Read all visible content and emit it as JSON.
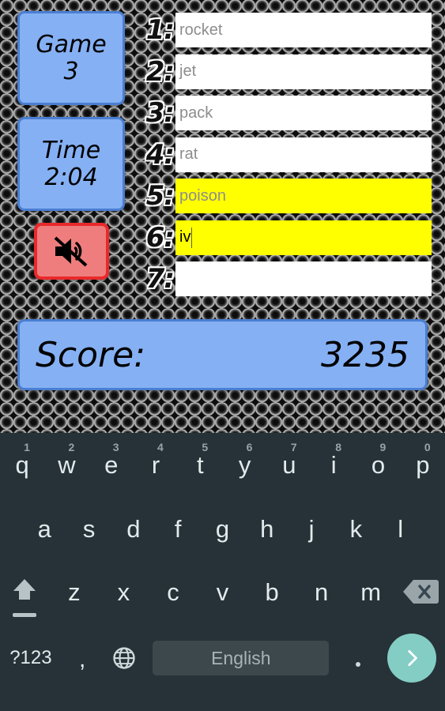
{
  "game": {
    "game_tile": {
      "label": "Game",
      "value": "3"
    },
    "time_tile": {
      "label": "Time",
      "value": "2:04"
    },
    "mute_button": {
      "icon": "speaker-mute-icon",
      "state": "muted"
    },
    "score": {
      "label": "Score:",
      "value": "3235"
    },
    "colors": {
      "tile_fill": "#85b0f3",
      "tile_border": "#4a7ed2",
      "mute_fill": "#ef7d7d",
      "mute_border": "#e8292c",
      "highlight_row": "#ffff00",
      "field_fill": "#ffffff",
      "background": "#8a8a8a"
    },
    "rows": [
      {
        "num": "1:",
        "value": "rocket",
        "highlight": false,
        "active": false
      },
      {
        "num": "2:",
        "value": "jet",
        "highlight": false,
        "active": false
      },
      {
        "num": "3:",
        "value": "pack",
        "highlight": false,
        "active": false
      },
      {
        "num": "4:",
        "value": "rat",
        "highlight": false,
        "active": false
      },
      {
        "num": "5:",
        "value": "poison",
        "highlight": true,
        "active": false
      },
      {
        "num": "6:",
        "value": "iv",
        "highlight": true,
        "active": true
      },
      {
        "num": "7:",
        "value": "",
        "highlight": false,
        "active": false
      }
    ]
  },
  "keyboard": {
    "language_label": "English",
    "symbols_label": "?123",
    "comma_label": ",",
    "period_label": ".",
    "globe_icon": "globe-icon",
    "shift_icon": "shift-icon",
    "backspace_icon": "backspace-icon",
    "enter_icon": "chevron-right-icon",
    "colors": {
      "background": "#263238",
      "key_text": "#e3eaec",
      "hint_text": "#96a3a8",
      "spacebar": "#3d484d",
      "enter": "#84cdc5"
    },
    "row1": [
      {
        "key": "q",
        "hint": "1"
      },
      {
        "key": "w",
        "hint": "2"
      },
      {
        "key": "e",
        "hint": "3"
      },
      {
        "key": "r",
        "hint": "4"
      },
      {
        "key": "t",
        "hint": "5"
      },
      {
        "key": "y",
        "hint": "6"
      },
      {
        "key": "u",
        "hint": "7"
      },
      {
        "key": "i",
        "hint": "8"
      },
      {
        "key": "o",
        "hint": "9"
      },
      {
        "key": "p",
        "hint": "0"
      }
    ],
    "row2": [
      {
        "key": "a"
      },
      {
        "key": "s"
      },
      {
        "key": "d"
      },
      {
        "key": "f"
      },
      {
        "key": "g"
      },
      {
        "key": "h"
      },
      {
        "key": "j"
      },
      {
        "key": "k"
      },
      {
        "key": "l"
      }
    ],
    "row3": [
      {
        "key": "z"
      },
      {
        "key": "x"
      },
      {
        "key": "c"
      },
      {
        "key": "v"
      },
      {
        "key": "b"
      },
      {
        "key": "n"
      },
      {
        "key": "m"
      }
    ]
  }
}
